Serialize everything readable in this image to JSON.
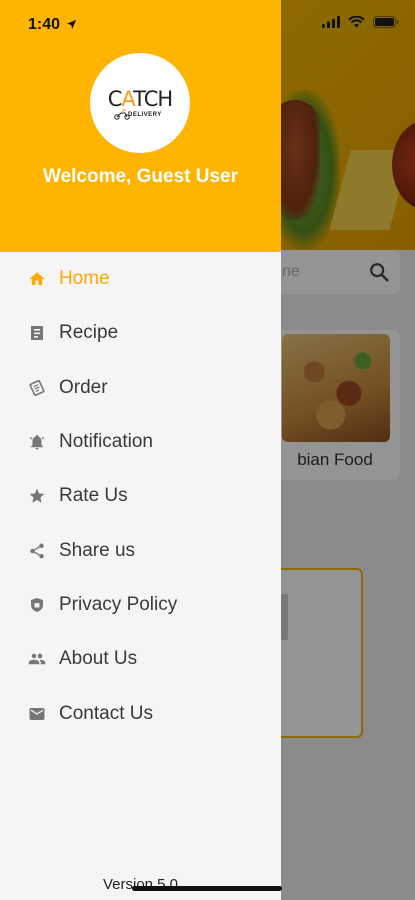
{
  "status_bar": {
    "time": "1:40"
  },
  "drawer": {
    "logo": {
      "prefix": "C",
      "accent": "A",
      "suffix": "TCH",
      "subtext": "DELIVERY"
    },
    "welcome_text": "Welcome, Guest User",
    "menu": [
      {
        "label": "Home",
        "icon": "home-icon",
        "active": true
      },
      {
        "label": "Recipe",
        "icon": "recipe-icon",
        "active": false
      },
      {
        "label": "Order",
        "icon": "order-icon",
        "active": false
      },
      {
        "label": "Notification",
        "icon": "bell-icon",
        "active": false
      },
      {
        "label": "Rate Us",
        "icon": "star-icon",
        "active": false
      },
      {
        "label": "Share us",
        "icon": "share-icon",
        "active": false
      },
      {
        "label": "Privacy Policy",
        "icon": "shield-icon",
        "active": false
      },
      {
        "label": "About Us",
        "icon": "people-icon",
        "active": false
      },
      {
        "label": "Contact Us",
        "icon": "mail-icon",
        "active": false
      }
    ],
    "version": "Version 5.0"
  },
  "background": {
    "search_placeholder": "ne",
    "card_caption": "bian Food"
  },
  "colors": {
    "accent": "#ffb400",
    "active_text": "#ffa800",
    "drawer_bg": "#f5f5f5"
  }
}
